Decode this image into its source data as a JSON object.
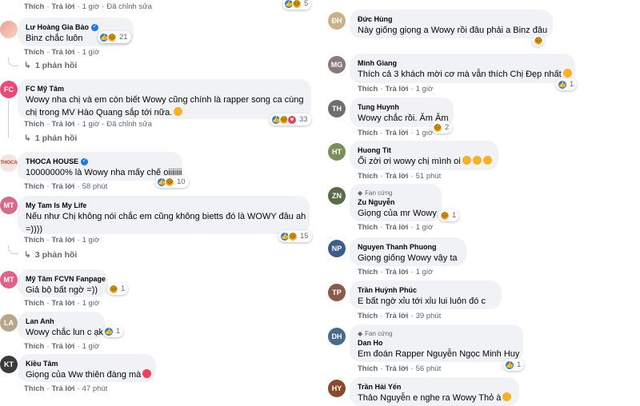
{
  "common": {
    "like": "Thích",
    "reply": "Trả lời",
    "edited": "Đã chỉnh sửa",
    "fan_badge": "Fan cứng"
  },
  "left": {
    "top_actions": {
      "time": "1 giờ",
      "edited": true,
      "react_count": "5"
    },
    "comments": [
      {
        "author": "Lư Hoàng Gia Bảo",
        "verified": true,
        "lines": [
          "Binz chắc luôn"
        ],
        "time": "1 giờ",
        "reactions": [
          "like",
          "haha"
        ],
        "count": "21",
        "replies": "1 phản hồi"
      },
      {
        "author": "FC Mỹ Tâm",
        "lines": [
          "Wowy nha chị và em còn biết Wowy cũng chính là rapper song ca cùng",
          "chị trong MV Hào Quang sắp tới nữa."
        ],
        "time": "1 giờ",
        "edited": true,
        "reactions": [
          "like",
          "haha",
          "love"
        ],
        "count": "33"
      },
      {
        "author": "THOCA HOUSE",
        "verified": true,
        "lines": [
          "10000000% là Wowy nha mấy chế oiiiiiii"
        ],
        "time": "58 phút",
        "reactions": [
          "like",
          "haha"
        ],
        "count": "10"
      },
      {
        "author": "My Tam Is My Life",
        "lines": [
          "Nếu như Chị không nói chắc em cũng không bietts đó là WOWY đâu ah",
          "=))))"
        ],
        "time": "1 giờ",
        "reactions": [
          "like",
          "haha"
        ],
        "count": "15",
        "replies": "3 phản hồi"
      },
      {
        "author": "Mỹ Tâm FCVN Fanpage",
        "lines": [
          "Giả bộ bất ngờ =))"
        ],
        "time": "1 giờ",
        "reactions": [
          "haha"
        ],
        "count": "1"
      },
      {
        "author": "Lan Anh",
        "lines": [
          "Wowy chắc lun c ạk"
        ],
        "time": "1 giờ",
        "reactions": [
          "like"
        ],
        "count": "1"
      },
      {
        "author": "Kiều Tâm",
        "lines": [
          "Giọng của Ww thiên đàng mà"
        ],
        "time": "47 phút",
        "reactions": []
      }
    ]
  },
  "right": {
    "comments": [
      {
        "author": "Đức Hùng",
        "lines": [
          "Này giống giọng a Wowy rồi đâu phải a Binz đâu"
        ],
        "reactions": [
          "haha"
        ],
        "count": ""
      },
      {
        "author": "Minh Giang",
        "lines": [
          "Thích cả 3 khách mời cơ mà vẫn thích Chị Đẹp nhất"
        ],
        "time": "1 giờ",
        "reactions": [
          "like"
        ],
        "count": "1"
      },
      {
        "author": "Tung Huynh",
        "lines": [
          "Wowy chắc rồi. Ăm Ăm"
        ],
        "time": "1 giờ",
        "reactions": [
          "haha"
        ],
        "count": "2"
      },
      {
        "author": "Huong Tit",
        "lines": [
          "Ối zời ơi wowy chị mình oi"
        ],
        "time": "51 phút",
        "reactions": []
      },
      {
        "author": "Zu Nguyễn",
        "fan": true,
        "lines": [
          "Giọng của mr Wowy"
        ],
        "time": "1 giờ",
        "reactions": [
          "haha"
        ],
        "count": "1"
      },
      {
        "author": "Nguyen Thanh Phuong",
        "lines": [
          "Giọng giống Wowy vậy ta"
        ],
        "time": "1 giờ",
        "reactions": []
      },
      {
        "author": "Trần Huỳnh Phúc",
        "lines": [
          "E bất ngờ xỉu tới xỉu lui luôn đó c"
        ],
        "time": "39 phút",
        "reactions": []
      },
      {
        "author": "Dan Ho",
        "fan": true,
        "lines": [
          "Em đoán Rapper Nguyễn Ngọc Minh Huy"
        ],
        "time": "56 phút",
        "reactions": [
          "like"
        ],
        "count": "1"
      },
      {
        "author": "Trần Hải Yến",
        "lines": [
          "Thảo Nguyễn e nghe ra Wowy Thỏ à"
        ],
        "reactions": []
      }
    ]
  },
  "colors": {
    "bubble": "#f0f2f5",
    "like_blue": "#1877f2",
    "haha_yellow": "#f7b125",
    "love_red": "#f33e58",
    "meta_gray": "#65676b"
  }
}
